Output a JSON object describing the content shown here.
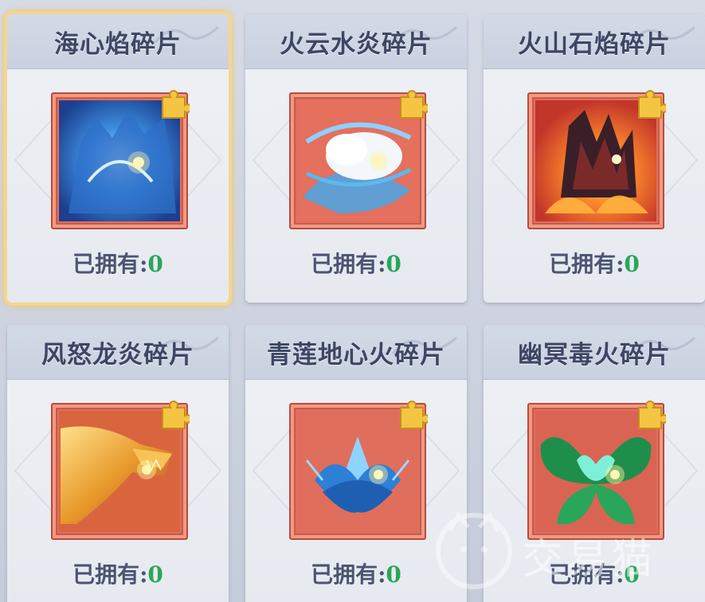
{
  "cards": [
    {
      "title": "海心焰碎片",
      "owned_label": "已拥有:",
      "owned_count": "0",
      "selected": true,
      "art": "blue-beast"
    },
    {
      "title": "火云水炎碎片",
      "owned_label": "已拥有:",
      "owned_count": "0",
      "selected": false,
      "art": "cloud-water"
    },
    {
      "title": "火山石焰碎片",
      "owned_label": "已拥有:",
      "owned_count": "0",
      "selected": false,
      "art": "volcano-rock"
    },
    {
      "title": "风怒龙炎碎片",
      "owned_label": "已拥有:",
      "owned_count": "0",
      "selected": false,
      "art": "golden-dragon"
    },
    {
      "title": "青莲地心火碎片",
      "owned_label": "已拥有:",
      "owned_count": "0",
      "selected": false,
      "art": "blue-lotus"
    },
    {
      "title": "幽冥毒火碎片",
      "owned_label": "已拥有:",
      "owned_count": "0",
      "selected": false,
      "art": "green-butterfly"
    }
  ],
  "watermark": {
    "text": "交易猫"
  },
  "colors": {
    "card_bg": "#eef1f5",
    "header_bg": "#d3dae7",
    "title_text": "#3d4763",
    "count_green": "#2aa65a",
    "art_frame": "#e06e5c",
    "puzzle_gold": "#f4c542",
    "selected_glow": "#f2c45b"
  }
}
